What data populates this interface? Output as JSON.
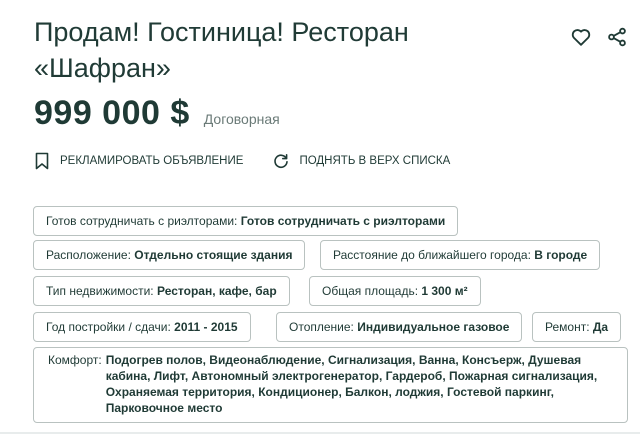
{
  "listing": {
    "title_line1": "Продам! Гостиница! Ресторан",
    "title_line2": "«Шафран»",
    "price": "999 000 $",
    "price_note": "Договорная"
  },
  "icons": {
    "favorite": "heart-icon",
    "share": "share-icon",
    "bookmark": "bookmark-icon",
    "refresh": "refresh-icon"
  },
  "actions": {
    "advertise": "РЕКЛАМИРОВАТЬ ОБЪЯВЛЕНИЕ",
    "bump": "ПОДНЯТЬ В ВЕРХ СПИСКА"
  },
  "params": {
    "realtors": {
      "label": "Готов сотрудничать с риэлторами:",
      "value": "Готов сотрудничать с риэлторами"
    },
    "location": {
      "label": "Расположение:",
      "value": "Отдельно стоящие здания"
    },
    "distance": {
      "label": "Расстояние до ближайшего города:",
      "value": "В городе"
    },
    "type": {
      "label": "Тип недвижимости:",
      "value": "Ресторан, кафе, бар"
    },
    "area": {
      "label": "Общая площадь:",
      "value": "1 300 м²"
    },
    "year": {
      "label": "Год постройки / сдачи:",
      "value": "2011 - 2015"
    },
    "heating": {
      "label": "Отопление:",
      "value": "Индивидуальное газовое"
    },
    "repair": {
      "label": "Ремонт:",
      "value": "Да"
    },
    "comfort": {
      "label": "Комфорт:",
      "value": "Подогрев полов, Видеонаблюдение, Сигнализация, Ванна, Консъерж, Душевая кабина, Лифт, Автономный электрогенератор, Гардероб, Пожарная сигнализация, Охраняемая территория, Кондиционер, Балкон, лоджия, Гостевой паркинг, Парковочное место"
    }
  },
  "colors": {
    "text": "#1f3a35",
    "border": "#b9c2c0",
    "muted": "#6a7a77"
  }
}
